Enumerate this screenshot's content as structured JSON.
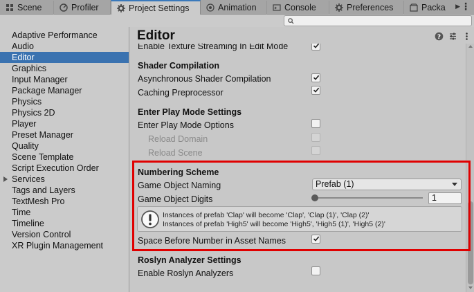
{
  "tabs": [
    {
      "label": "Scene",
      "icon": "grid-icon"
    },
    {
      "label": "Profiler",
      "icon": "profiler-icon"
    },
    {
      "label": "Project Settings",
      "icon": "gear-icon",
      "active": true
    },
    {
      "label": "Animation",
      "icon": "animation-icon"
    },
    {
      "label": "Console",
      "icon": "console-icon"
    },
    {
      "label": "Preferences",
      "icon": "gear-icon"
    },
    {
      "label": "Packa",
      "icon": "package-icon"
    }
  ],
  "search": {
    "placeholder": "",
    "value": ""
  },
  "sidebar": {
    "items": [
      {
        "label": "Adaptive Performance"
      },
      {
        "label": "Audio"
      },
      {
        "label": "Editor",
        "selected": true
      },
      {
        "label": "Graphics"
      },
      {
        "label": "Input Manager"
      },
      {
        "label": "Package Manager"
      },
      {
        "label": "Physics"
      },
      {
        "label": "Physics 2D"
      },
      {
        "label": "Player"
      },
      {
        "label": "Preset Manager"
      },
      {
        "label": "Quality"
      },
      {
        "label": "Scene Template"
      },
      {
        "label": "Script Execution Order"
      },
      {
        "label": "Services",
        "expandable": true
      },
      {
        "label": "Tags and Layers"
      },
      {
        "label": "TextMesh Pro"
      },
      {
        "label": "Time"
      },
      {
        "label": "Timeline"
      },
      {
        "label": "Version Control"
      },
      {
        "label": "XR Plugin Management"
      }
    ]
  },
  "main": {
    "title": "Editor",
    "texture_streaming_label": "Enable Texture Streaming In Edit Mode",
    "shader_compilation": {
      "heading": "Shader Compilation",
      "async_label": "Asynchronous Shader Compilation",
      "caching_label": "Caching Preprocessor"
    },
    "play_mode": {
      "heading": "Enter Play Mode Settings",
      "options_label": "Enter Play Mode Options",
      "reload_domain_label": "Reload Domain",
      "reload_scene_label": "Reload Scene"
    },
    "numbering": {
      "heading": "Numbering Scheme",
      "naming_label": "Game Object Naming",
      "naming_value": "Prefab (1)",
      "digits_label": "Game Object Digits",
      "digits_value": "1",
      "help_line_1": "Instances of prefab 'Clap' will become 'Clap', 'Clap (1)', 'Clap (2)'",
      "help_line_2": "Instances of prefab 'High5' will become 'High5', 'High5 (1)', 'High5 (2)'",
      "space_label": "Space Before Number in Asset Names"
    },
    "roslyn": {
      "heading": "Roslyn Analyzer Settings",
      "enable_label": "Enable Roslyn Analyzers"
    }
  },
  "colors": {
    "selection": "#3a72b0",
    "highlight": "#e00000",
    "active_tab_accent": "#3a79bb"
  }
}
